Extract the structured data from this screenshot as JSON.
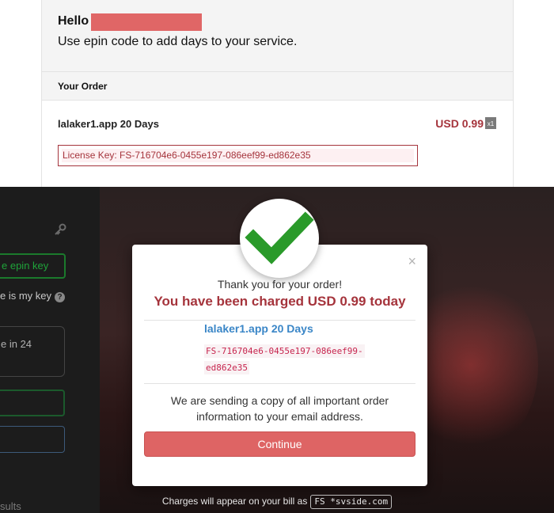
{
  "email": {
    "greeting": "Hello",
    "intro": "Use epin code to add days to your service.",
    "order_heading": "Your Order",
    "product_name": "lalaker1.app 20 Days",
    "price": "USD 0.99",
    "quantity": "x1",
    "license_key": "License Key: FS-716704e6-0455e197-086eef99-ed862e35",
    "redaction_color": "#e06666"
  },
  "background_page": {
    "button_fragment": "e epin key",
    "link_fragment": "e is my key",
    "box_fragment": "e in 24",
    "results_fragment": "sults"
  },
  "modal": {
    "icon": "checkmark-icon",
    "thanks": "Thank you for your order!",
    "charged": "You have been charged USD 0.99 today",
    "product_name": "lalaker1.app 20 Days",
    "key_line1": "FS-716704e6-0455e197-086eef99-",
    "key_line2": "ed862e35",
    "note_line1": "We are sending a copy of all important order",
    "note_line2": "information to your email address.",
    "continue_label": "Continue",
    "close_symbol": "×"
  },
  "bill": {
    "text": "Charges will appear on your bill as",
    "code": "FS *svside.com"
  },
  "colors": {
    "accent_red": "#a5343c",
    "button_red": "#de6464",
    "link_blue": "#3a86c7",
    "check_green": "#2a9a2a"
  }
}
